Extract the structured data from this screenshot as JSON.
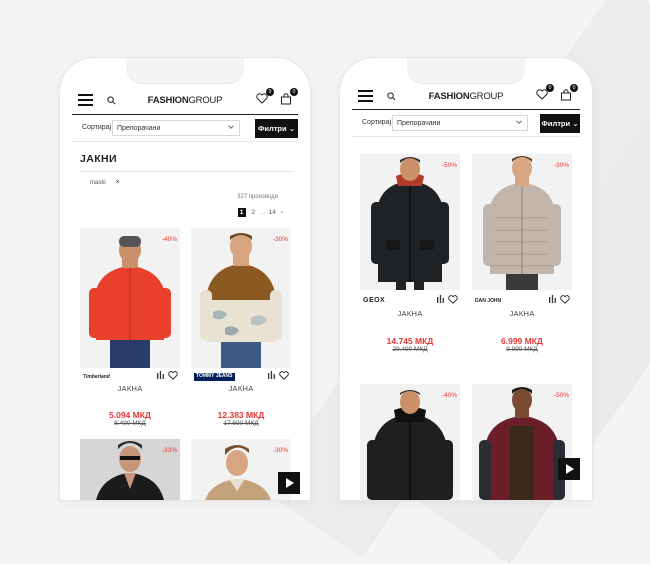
{
  "header": {
    "logo_bold": "FASHION",
    "logo_light": "GROUP",
    "wishlist_count": "0",
    "cart_count": "0"
  },
  "sort": {
    "label": "Сортирај",
    "selected": "Препорачани",
    "filter_label": "Филтри"
  },
  "listing": {
    "title": "ЈАКНИ",
    "active_filter": "maski",
    "remove_filter": "×",
    "product_count": "327 производи",
    "pagination": {
      "current": "1",
      "next": "2",
      "ellipsis": "...",
      "last": "14",
      "next_arrow": "›"
    }
  },
  "products_left": [
    {
      "discount": "-40%",
      "brand": "Timberland",
      "name": "ЈАКНА",
      "price": "5.094 МКД",
      "old_price": "8.490 МКД"
    },
    {
      "discount": "-30%",
      "brand": "TOMMY JEANS",
      "name": "ЈАКНА",
      "price": "12.383 МКД",
      "old_price": "17.690 МКД"
    },
    {
      "discount": "-33%"
    },
    {
      "discount": "-30%"
    }
  ],
  "products_right": [
    {
      "discount": "-50%",
      "brand": "GEOX",
      "name": "ЈАКНА",
      "price": "14.745 МКД",
      "old_price": "29.490 МКД"
    },
    {
      "discount": "-30%",
      "brand": "DAN JOHN",
      "name": "ЈАКНА",
      "price": "6.999 МКД",
      "old_price": "9.990 МКД"
    },
    {
      "discount": "-40%"
    },
    {
      "discount": "-50%"
    }
  ],
  "colors": {
    "accent_red": "#e53935",
    "black": "#111111",
    "bg": "#f4f4f4"
  }
}
